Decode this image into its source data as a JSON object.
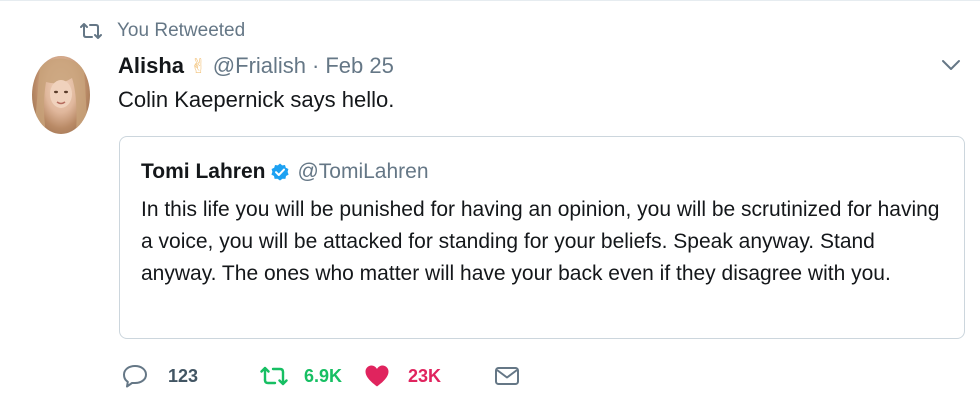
{
  "retweet_context": {
    "label": "You Retweeted",
    "icon": "retweet-icon"
  },
  "tweet": {
    "author_name": "Alisha",
    "author_emoji": "✌",
    "author_handle": "@Frialish",
    "separator": "·",
    "date": "Feb 25",
    "text": "Colin Kaepernick says hello.",
    "avatar_icon": "avatar"
  },
  "quoted_tweet": {
    "author_name": "Tomi Lahren",
    "verified_icon": "verified-badge-icon",
    "author_handle": "@TomiLahren",
    "text": "In this life you will be punished for having an opinion, you will be scrutinized for having a voice, you will be attacked for standing for your beliefs. Speak anyway. Stand anyway. The ones who matter will have your back even if they disagree with you."
  },
  "actions": {
    "reply_count": "123",
    "retweet_count": "6.9K",
    "like_count": "23K"
  },
  "colors": {
    "retweet_active": "#17bf63",
    "like_active": "#e0245e",
    "verified_blue": "#1da1f2",
    "secondary_text": "#657786"
  }
}
